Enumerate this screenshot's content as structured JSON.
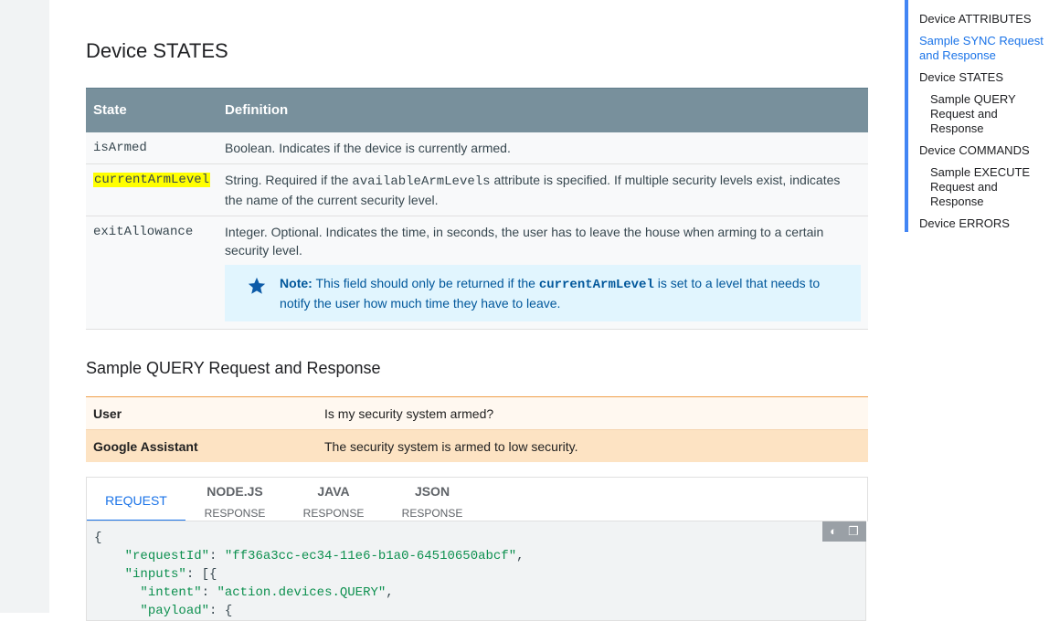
{
  "toc": {
    "items": [
      {
        "label": "Device ATTRIBUTES",
        "level": 1
      },
      {
        "label": "Sample SYNC Request and Response",
        "level": 1,
        "current": true
      },
      {
        "label": "Device STATES",
        "level": 1
      },
      {
        "label": "Sample QUERY Request and Response",
        "level": 2
      },
      {
        "label": "Device COMMANDS",
        "level": 1
      },
      {
        "label": "Sample EXECUTE Request and Response",
        "level": 2
      },
      {
        "label": "Device ERRORS",
        "level": 1
      }
    ]
  },
  "states_section": {
    "title": "Device STATES",
    "headers": {
      "state": "State",
      "definition": "Definition"
    },
    "rows": [
      {
        "state": "isArmed",
        "definition": "Boolean. Indicates if the device is currently armed."
      },
      {
        "state": "currentArmLevel",
        "definition_pre": "String. Required if the ",
        "definition_code": "availableArmLevels",
        "definition_post": " attribute is specified. If multiple security levels exist, indicates the name of the current security level."
      },
      {
        "state": "exitAllowance",
        "definition": "Integer. Optional. Indicates the time, in seconds, the user has to leave the house when arming to a certain security level."
      }
    ],
    "note": {
      "label": "Note:",
      "pre": " This field should only be returned if the ",
      "code": "currentArmLevel",
      "post": " is set to a level that needs to notify the user how much time they have to leave."
    }
  },
  "query_section": {
    "title": "Sample QUERY Request and Response",
    "dialog": [
      {
        "speaker": "User",
        "text": "Is my security system armed?"
      },
      {
        "speaker": "Google Assistant",
        "text": "The security system is armed to low security."
      }
    ],
    "tabs": [
      {
        "line1": "REQUEST",
        "line2": "",
        "active": true
      },
      {
        "line1": "NODE.JS",
        "line2": "RESPONSE"
      },
      {
        "line1": "JAVA",
        "line2": "RESPONSE"
      },
      {
        "line1": "JSON",
        "line2": "RESPONSE"
      }
    ],
    "code": {
      "lines": [
        "{",
        "    \"requestId\": \"ff36a3cc-ec34-11e6-b1a0-64510650abcf\",",
        "    \"inputs\": [{",
        "      \"intent\": \"action.devices.QUERY\",",
        "      \"payload\": {"
      ]
    }
  },
  "colors": {
    "header_bg": "#78909c",
    "highlight": "#ffff00",
    "note_bg": "#e1f5fe",
    "accent": "#1a73e8"
  }
}
